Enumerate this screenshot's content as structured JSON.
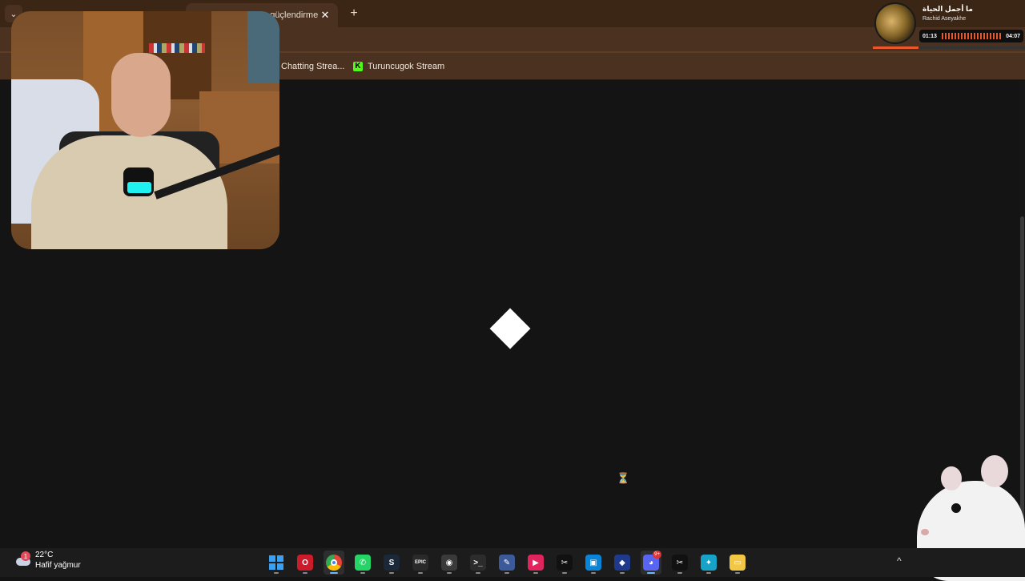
{
  "browser": {
    "active_tab_title": "ını güçlendirmek",
    "close_glyph": "✕",
    "new_tab_glyph": "+",
    "tab_search_glyph": "⌄"
  },
  "bookmarks": [
    {
      "label": "Chatting Strea...",
      "icon": "kick-icon"
    },
    {
      "label": "Turuncugok Stream",
      "icon": "kick-icon"
    }
  ],
  "music_widget": {
    "title": "ما أجمل الحياة",
    "artist": "Rachid Aseyakhe",
    "elapsed": "01:13",
    "duration": "04:07",
    "progress_fraction": 0.3,
    "accent_color": "#e8582b"
  },
  "page": {
    "loader_icon": "loading-diamond-icon",
    "cursor_glyph": "⏳"
  },
  "taskbar": {
    "weather": {
      "temperature": "22°C",
      "condition": "Hafif yağmur",
      "badge": "1"
    },
    "apps": [
      {
        "name": "start-button",
        "glyph": "",
        "color": "#0078d4",
        "active": false
      },
      {
        "name": "opera-icon",
        "glyph": "O",
        "color": "#cc1c2c",
        "active": false
      },
      {
        "name": "chrome-icon",
        "glyph": "",
        "color": "#4285f4",
        "active": true
      },
      {
        "name": "whatsapp-icon",
        "glyph": "✆",
        "color": "#25d366",
        "active": false
      },
      {
        "name": "steam-icon",
        "glyph": "S",
        "color": "#1b2838",
        "active": false
      },
      {
        "name": "epic-games-icon",
        "glyph": "EPIC",
        "color": "#2a2a2a",
        "active": false
      },
      {
        "name": "obs-icon",
        "glyph": "◉",
        "color": "#3a3a3a",
        "active": false
      },
      {
        "name": "terminal-icon",
        "glyph": ">_",
        "color": "#2c2c2c",
        "active": false
      },
      {
        "name": "image-editor-icon",
        "glyph": "✎",
        "color": "#3c5a9a",
        "active": false
      },
      {
        "name": "media-player-icon",
        "glyph": "▶",
        "color": "#e0245e",
        "active": false
      },
      {
        "name": "capcut-icon",
        "glyph": "✂",
        "color": "#111111",
        "active": false
      },
      {
        "name": "store-icon",
        "glyph": "▣",
        "color": "#0a84d6",
        "active": false
      },
      {
        "name": "game-launcher-icon",
        "glyph": "◆",
        "color": "#1f3a8a",
        "active": false
      },
      {
        "name": "discord-icon",
        "glyph": "◕",
        "color": "#5865f2",
        "active": true,
        "badge": "9+"
      },
      {
        "name": "capcut-2-icon",
        "glyph": "✂",
        "color": "#111111",
        "active": false
      },
      {
        "name": "kodi-icon",
        "glyph": "✦",
        "color": "#17a2c8",
        "active": false
      },
      {
        "name": "file-explorer-icon",
        "glyph": "▭",
        "color": "#f2c744",
        "active": false
      }
    ],
    "tray_chevron": "^"
  }
}
